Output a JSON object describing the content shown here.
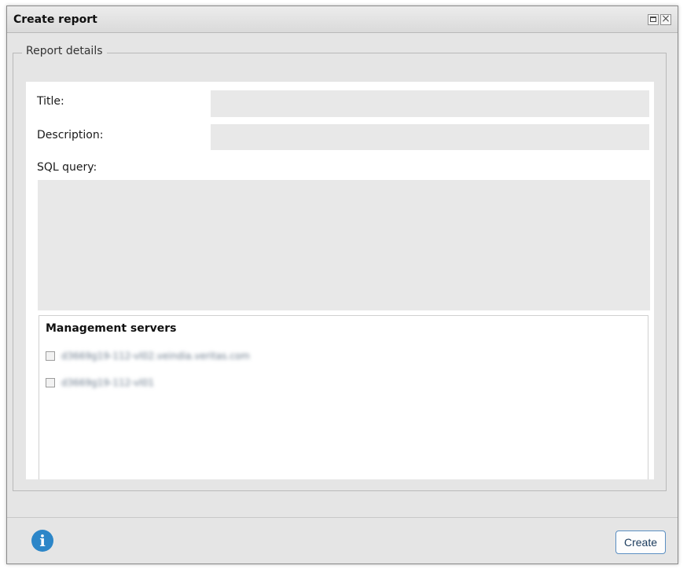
{
  "dialog": {
    "title": "Create report",
    "legend": "Report details"
  },
  "form": {
    "title_label": "Title:",
    "title_value": "",
    "description_label": "Description:",
    "description_value": "",
    "sql_label": "SQL query:",
    "sql_value": ""
  },
  "management_servers": {
    "heading": "Management servers",
    "servers": [
      {
        "label": "d3669g19-112-vl02.veindia.veritas.com",
        "checked": false
      },
      {
        "label": "d3669g19-112-vl01",
        "checked": false
      }
    ]
  },
  "footer": {
    "create_label": "Create",
    "info_glyph": "i",
    "info_icon": "info-circle-icon"
  },
  "colors": {
    "accent": "#2c86c8",
    "field_bg": "#e8e8e8",
    "dialog_bg": "#e5e5e5"
  }
}
